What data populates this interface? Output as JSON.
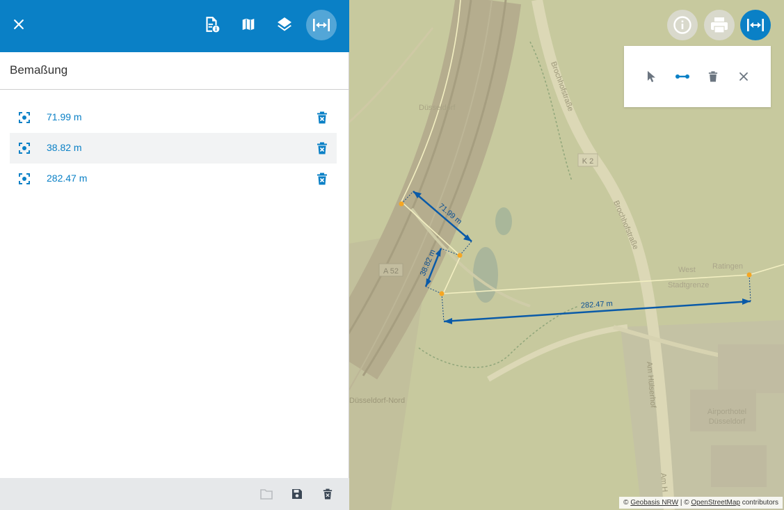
{
  "panel": {
    "title": "Bemaßung",
    "measurements": [
      {
        "value": "71.99 m"
      },
      {
        "value": "38.82 m"
      },
      {
        "value": "282.47 m"
      }
    ]
  },
  "map": {
    "labels": {
      "duesseldorf_nord": "Düsseldorf-Nord",
      "brochhofstrasse_1": "Brochhofstraße",
      "brochhofstrasse_2": "Brochhofstraße",
      "k2": "K 2",
      "a52": "A 52",
      "am_huelserhof": "Am Hülserhof",
      "am_huelserhof_2": "Am H",
      "airporthotel_1": "Airporthotel",
      "airporthotel_2": "Düsseldorf",
      "west": "West",
      "ratingen": "Ratingen",
      "stadtgrenze": "Stadtgrenze",
      "duesseldorf_top": "Düsseldorf"
    },
    "dimensions": {
      "d1": "71.99 m",
      "d2": "38.82 m",
      "d3": "282.47 m"
    },
    "attribution": {
      "prefix": "© ",
      "geobasis": "Geobasis NRW",
      "sep": " | © ",
      "osm": "OpenStreetMap",
      "suffix": " contributors"
    }
  },
  "colors": {
    "primary": "#0a80c6",
    "measure_line": "#0a5aa8",
    "vertex": "#f5a623",
    "map_bg": "#c9caa0"
  },
  "icons": {
    "close": "close-icon",
    "doc_info": "document-info-icon",
    "map": "map-icon",
    "layers": "layers-icon",
    "measure": "measure-icon",
    "zoom_to": "focus-icon",
    "delete": "delete-icon",
    "folder": "folder-icon",
    "save": "save-icon",
    "info": "info-icon",
    "print": "print-icon",
    "select": "pointer-icon",
    "line": "line-icon",
    "trash": "trash-icon"
  }
}
